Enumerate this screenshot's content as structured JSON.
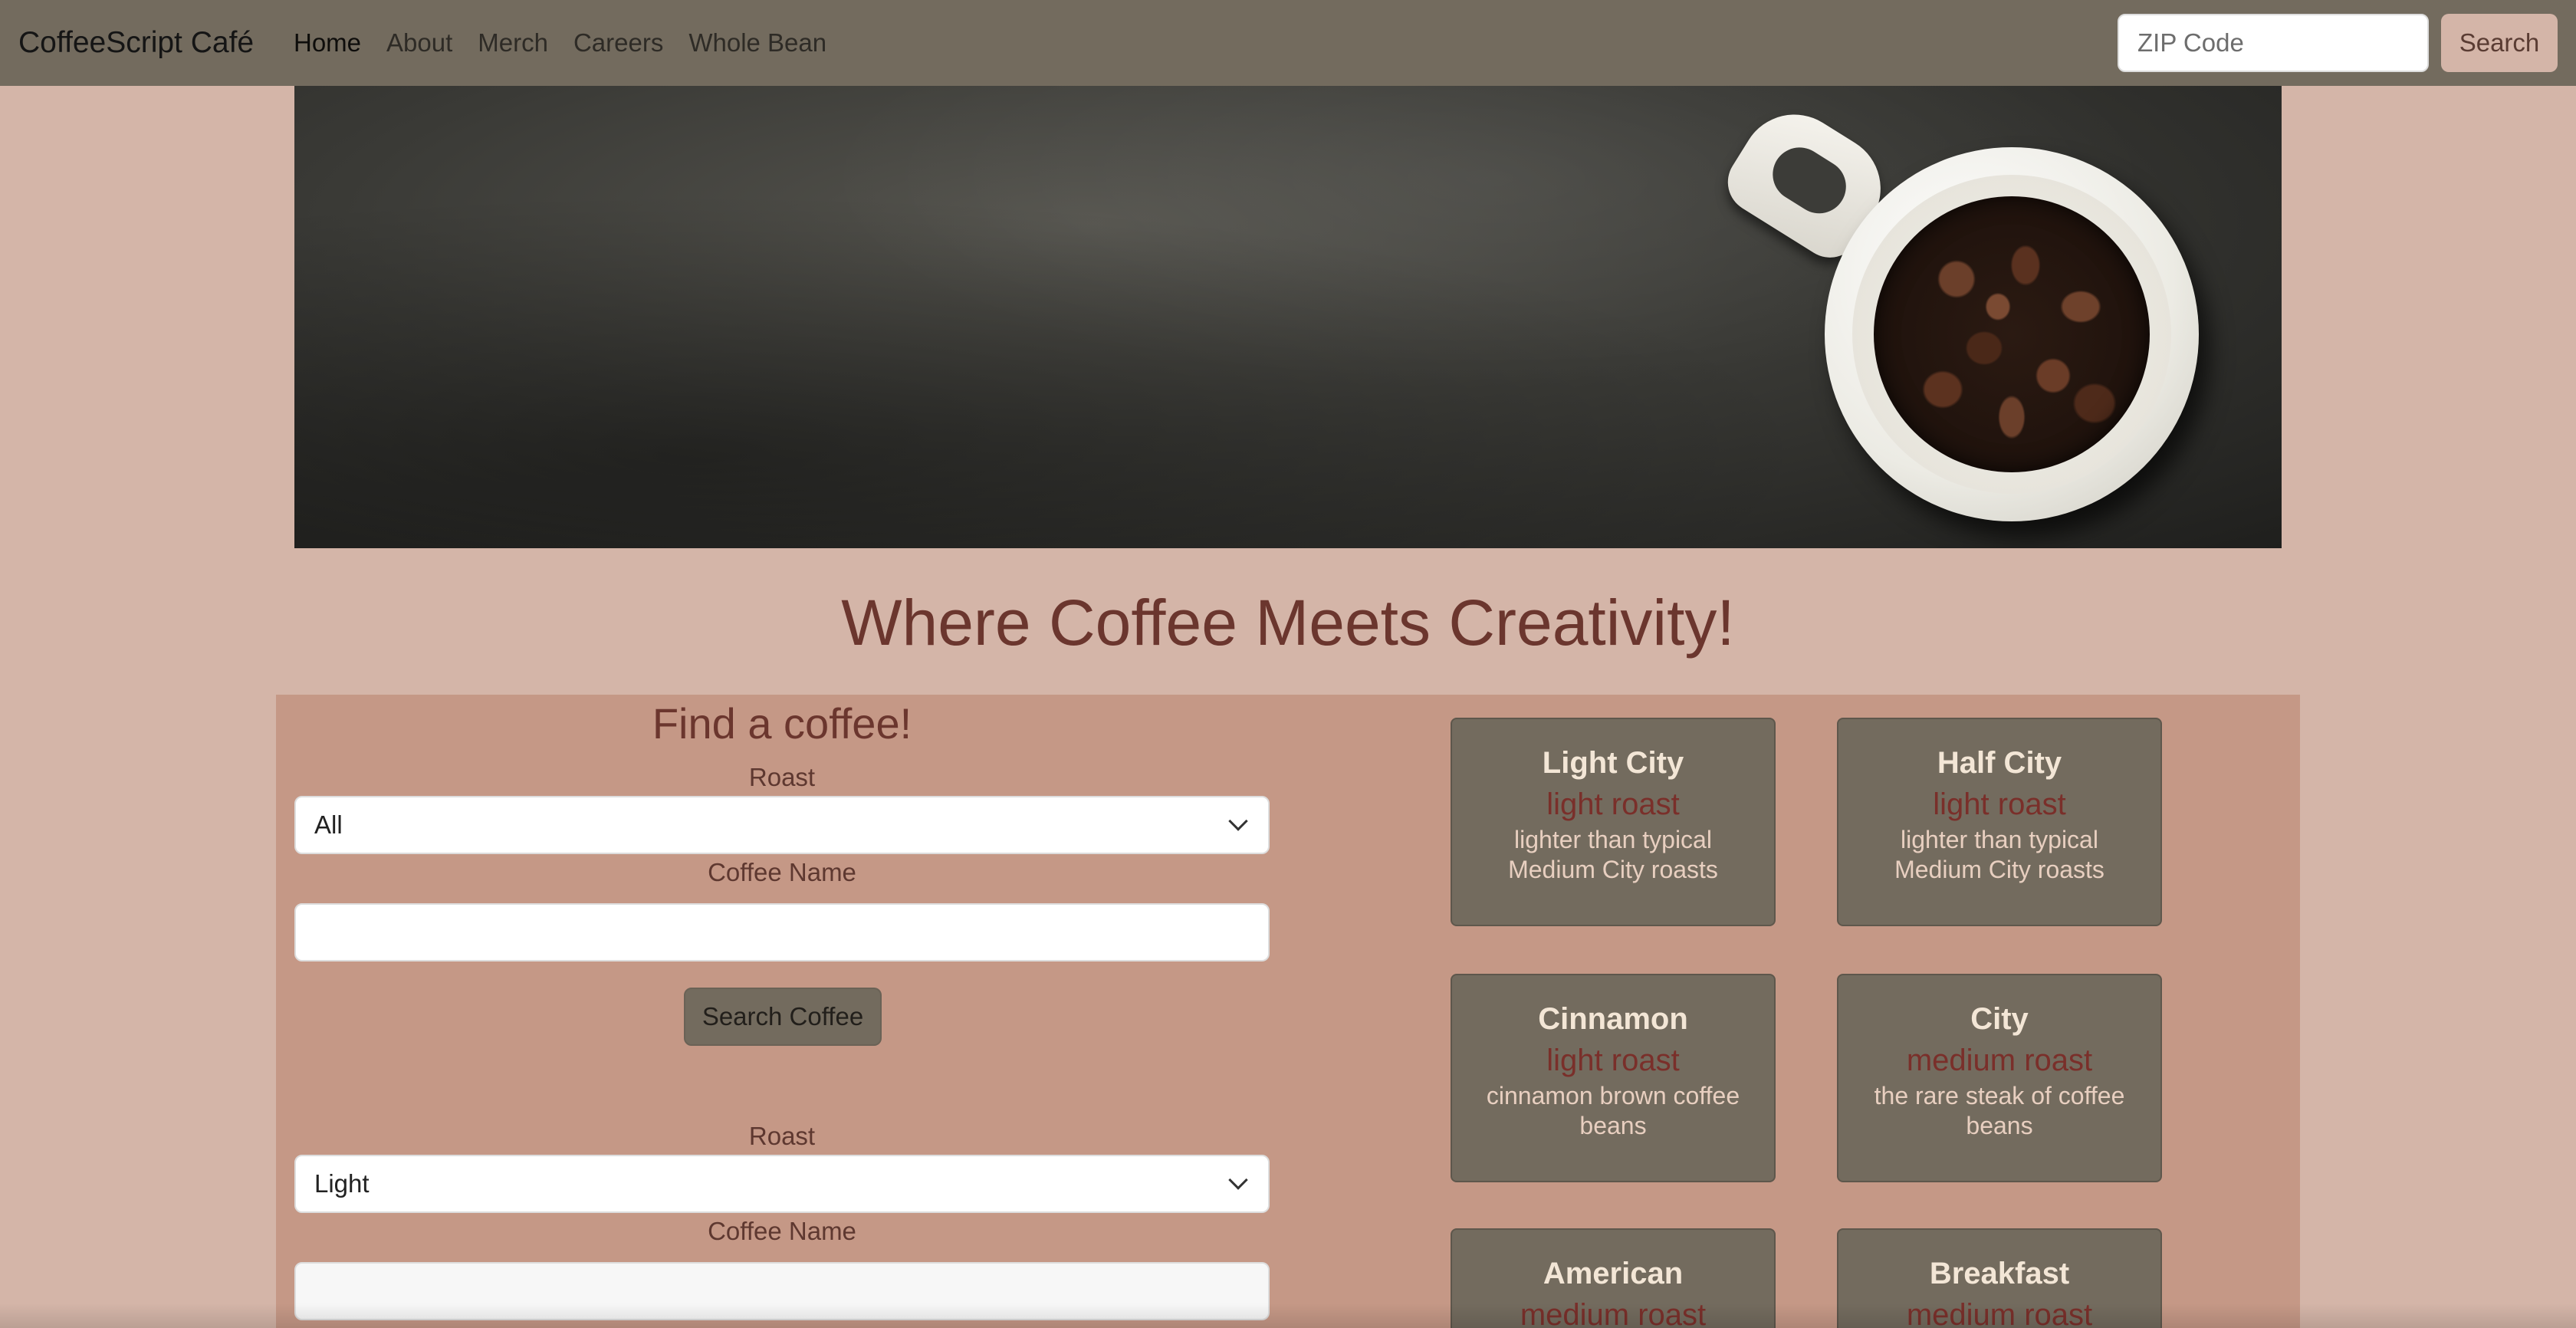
{
  "navbar": {
    "brand": "CoffeeScript Café",
    "links": [
      {
        "label": "Home",
        "active": true
      },
      {
        "label": "About"
      },
      {
        "label": "Merch"
      },
      {
        "label": "Careers"
      },
      {
        "label": "Whole Bean"
      }
    ],
    "zip_placeholder": "ZIP Code",
    "search_label": "Search"
  },
  "hero": {
    "image": "coffee-mug-with-beans"
  },
  "headline": "Where Coffee Meets Creativity!",
  "find": {
    "title": "Find a coffee!",
    "search_form": {
      "roast_label": "Roast",
      "roast_selected": "All",
      "name_label": "Coffee Name",
      "name_value": "",
      "button_label": "Search Coffee"
    },
    "add_form": {
      "roast_label": "Roast",
      "roast_selected": "Light",
      "name_label": "Coffee Name",
      "name_value": ""
    }
  },
  "coffees": [
    {
      "name": "Light City",
      "roast": "light roast",
      "desc": "lighter than typical Medium City roasts"
    },
    {
      "name": "Half City",
      "roast": "light roast",
      "desc": "lighter than typical Medium City roasts"
    },
    {
      "name": "Cinnamon",
      "roast": "light roast",
      "desc": "cinnamon brown coffee beans"
    },
    {
      "name": "City",
      "roast": "medium roast",
      "desc": "the rare steak of coffee beans"
    },
    {
      "name": "American",
      "roast": "medium roast",
      "desc": ""
    },
    {
      "name": "Breakfast",
      "roast": "medium roast",
      "desc": ""
    }
  ],
  "colors": {
    "navbar_bg": "#736b5e",
    "page_bg": "#d4b5a8",
    "section_bg": "#c59886",
    "accent": "#6b362e"
  }
}
